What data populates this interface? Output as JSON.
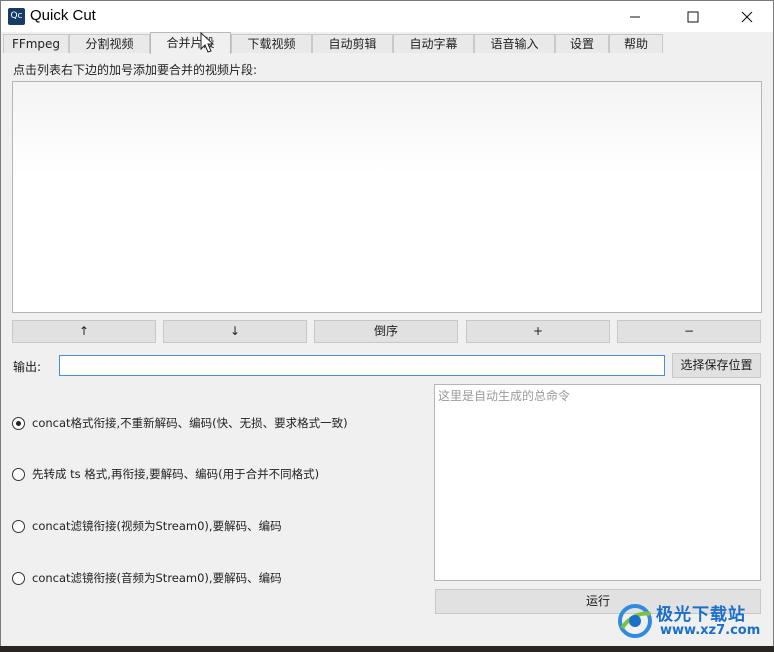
{
  "window": {
    "title": "Quick Cut",
    "icon_text": "Qc"
  },
  "tabs": [
    {
      "label": "FFmpeg",
      "active": false
    },
    {
      "label": "分割视频",
      "active": false
    },
    {
      "label": "合并片段",
      "active": true
    },
    {
      "label": "下载视频",
      "active": false
    },
    {
      "label": "自动剪辑",
      "active": false
    },
    {
      "label": "自动字幕",
      "active": false
    },
    {
      "label": "语音输入",
      "active": false
    },
    {
      "label": "设置",
      "active": false
    },
    {
      "label": "帮助",
      "active": false
    }
  ],
  "merge": {
    "hint": "点击列表右下边的加号添加要合并的视频片段:",
    "list_items": [],
    "buttons": {
      "up": "↑",
      "down": "↓",
      "reverse": "倒序",
      "add": "+",
      "remove": "−"
    },
    "output_label": "输出:",
    "output_value": "",
    "choose_save_label": "选择保存位置",
    "options": [
      {
        "label": "concat格式衔接,不重新解码、编码(快、无损、要求格式一致)",
        "checked": true
      },
      {
        "label": "先转成 ts 格式,再衔接,要解码、编码(用于合并不同格式)",
        "checked": false
      },
      {
        "label": "concat滤镜衔接(视频为Stream0),要解码、编码",
        "checked": false
      },
      {
        "label": "concat滤镜衔接(音频为Stream0),要解码、编码",
        "checked": false
      }
    ],
    "command_placeholder": "这里是自动生成的总命令",
    "run_label": "运行"
  },
  "watermark": {
    "name": "极光下载站",
    "url": "www.xz7.com"
  },
  "colors": {
    "window_bg": "#f0f0f0",
    "focus_border": "#4a8fd0",
    "watermark_blue": "#1a6fc9"
  }
}
